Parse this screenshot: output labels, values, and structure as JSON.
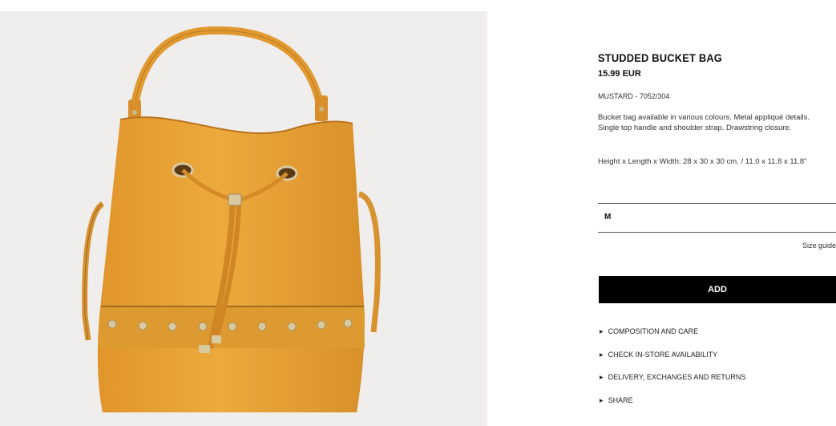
{
  "product": {
    "title": "STUDDED BUCKET BAG",
    "price": "15.99 EUR",
    "ref": "MUSTARD - 7052/304",
    "description": "Bucket bag available in various colours. Metal appliqué details. Single top handle and shoulder strap. Drawstring closure.",
    "dimensions": "Height x Length x Width: 28 x 30 x 30 cm. / 11.0 x 11.8 x 11.8\"",
    "image": "bucket-bag-photo"
  },
  "size": {
    "selected": "M",
    "guide_label": "Size guide"
  },
  "actions": {
    "add_label": "ADD"
  },
  "accordion": [
    {
      "label": "COMPOSITION AND CARE",
      "icon": "triangle-right-icon"
    },
    {
      "label": "CHECK IN-STORE AVAILABILITY",
      "icon": "triangle-right-icon"
    },
    {
      "label": "DELIVERY, EXCHANGES AND RETURNS",
      "icon": "triangle-right-icon"
    },
    {
      "label": "SHARE",
      "icon": "triangle-right-icon"
    }
  ],
  "colors": {
    "bag": "#e9a233",
    "background": "#efeeed",
    "button": "#000000"
  }
}
